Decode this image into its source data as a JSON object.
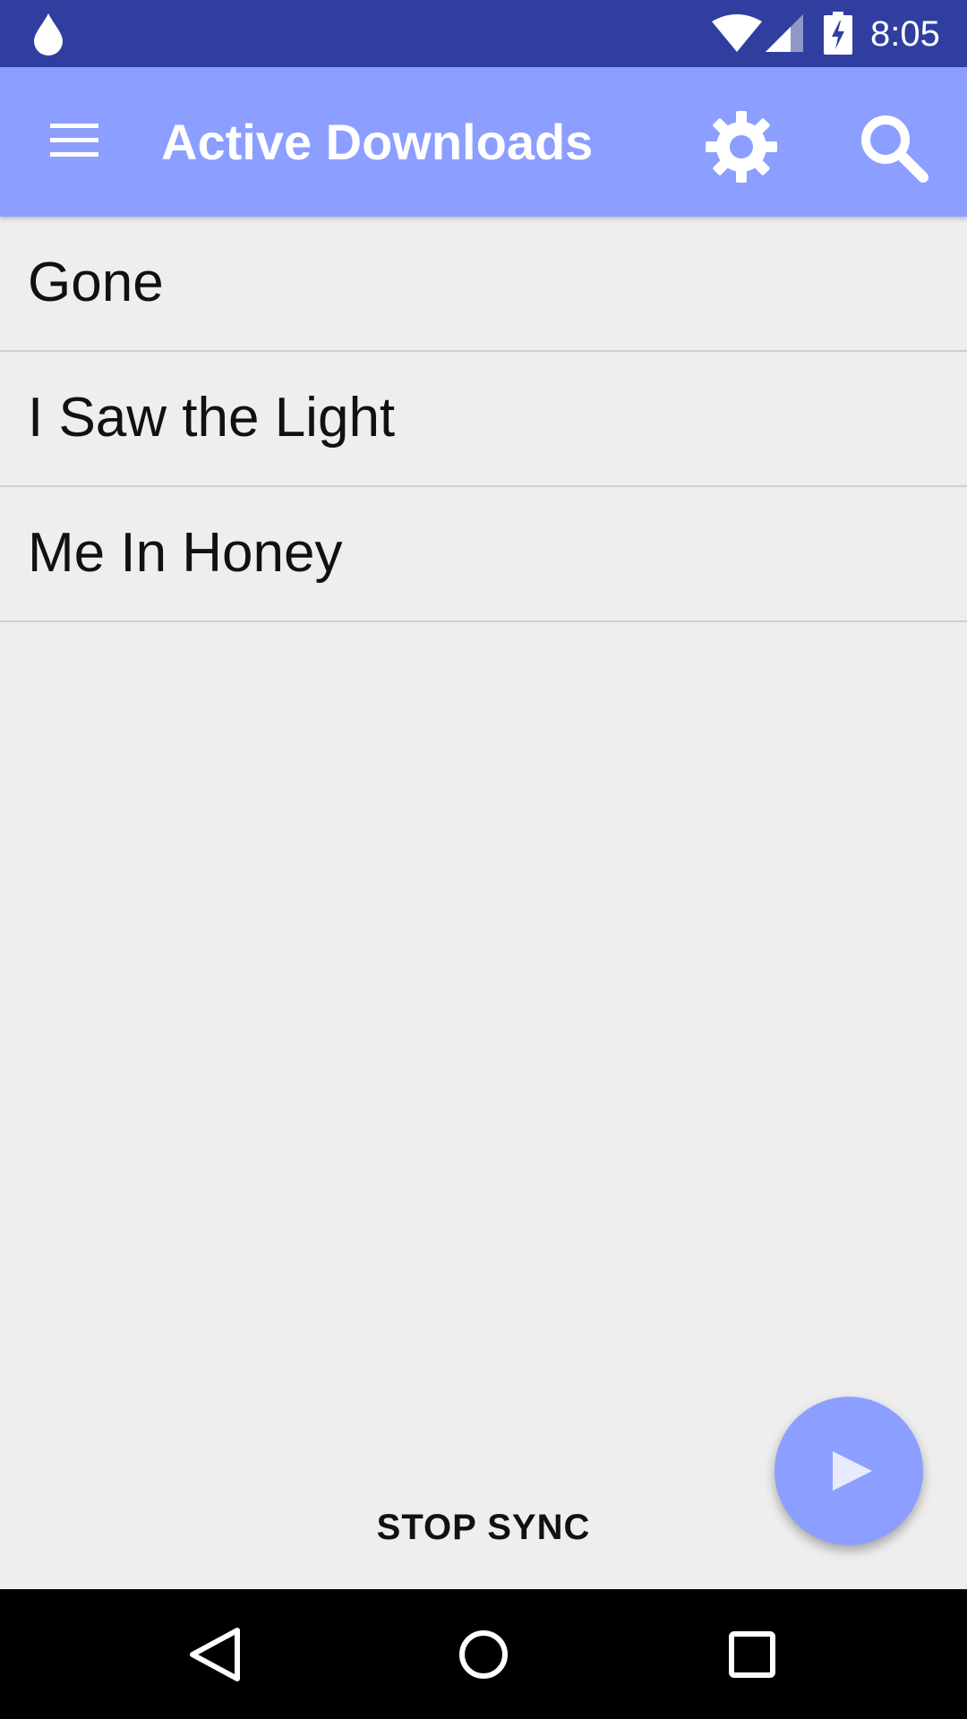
{
  "status_bar": {
    "time": "8:05",
    "icons": [
      "water-drop-icon",
      "wifi-icon",
      "signal-icon",
      "battery-charging-icon"
    ],
    "background": "#303f9f"
  },
  "app_bar": {
    "title": "Active Downloads",
    "background": "#8c9eff",
    "icons": [
      "menu-icon",
      "gear-icon",
      "search-icon"
    ]
  },
  "downloads": {
    "items": [
      {
        "title": "Gone"
      },
      {
        "title": "I Saw the Light"
      },
      {
        "title": "Me In Honey"
      }
    ]
  },
  "footer": {
    "stop_sync_label": "STOP SYNC"
  },
  "fab": {
    "icon": "play-icon",
    "background": "#8c9eff"
  },
  "nav_bar": {
    "icons": [
      "back-icon",
      "home-icon",
      "recents-icon"
    ]
  }
}
